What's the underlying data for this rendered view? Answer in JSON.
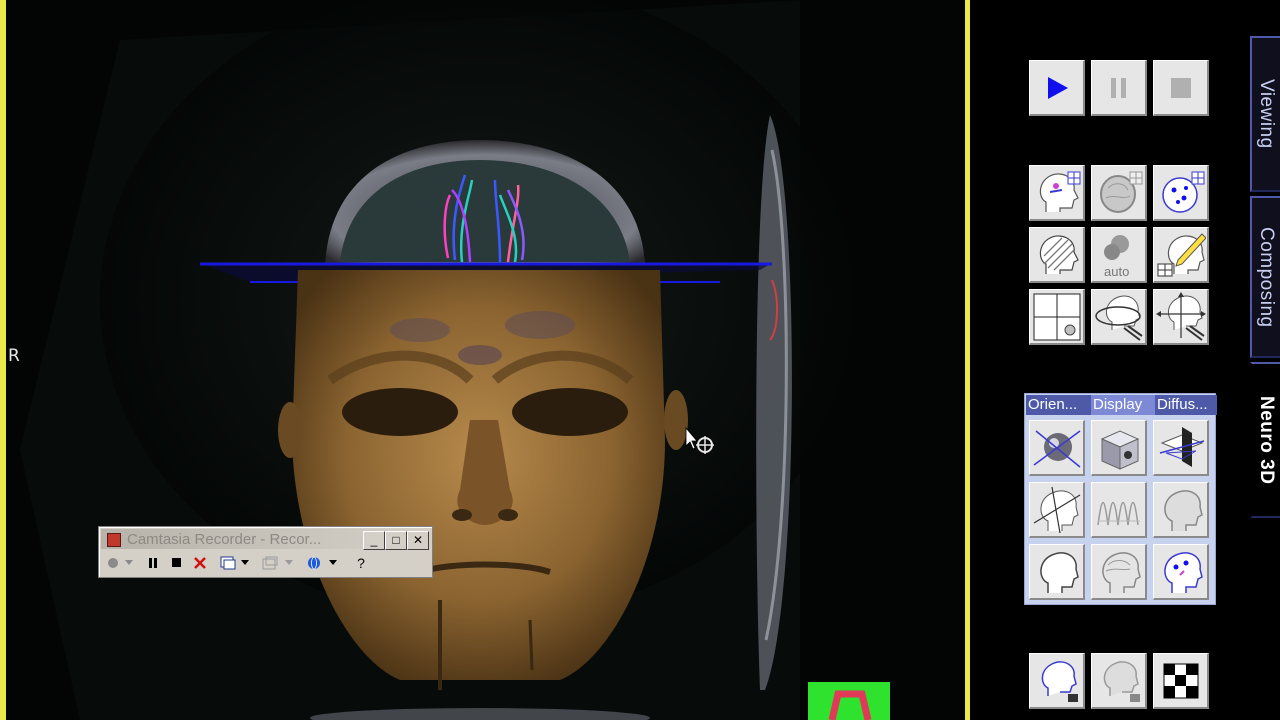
{
  "viewer": {
    "orientation_label": "R"
  },
  "camtasia": {
    "title": "Camtasia Recorder - Recor...",
    "min_glyph": "_",
    "max_glyph": "□",
    "close_glyph": "✕",
    "help_glyph": "?"
  },
  "playback": {
    "play_icon": "play-icon",
    "pause_icon": "pause-icon",
    "stop_icon": "stop-icon"
  },
  "tools": {
    "auto_label": "auto"
  },
  "subpanel": {
    "tabs": [
      "Orien...",
      "Display",
      "Diffus..."
    ],
    "active_tab": 1
  },
  "side_tabs": [
    "Viewing",
    "Composing",
    "Neuro 3D"
  ],
  "active_side_tab": 2,
  "colors": {
    "accent_yellow": "#e9e94a",
    "tab_blue": "#4e5aa8",
    "subpanel_bg": "#c7d2ef",
    "play_blue": "#1010ee"
  }
}
